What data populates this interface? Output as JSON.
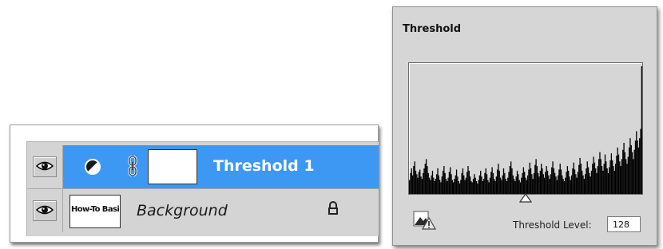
{
  "layers": {
    "items": [
      {
        "name": "Threshold 1",
        "selected": true,
        "kind": "adjustment",
        "thumbnail": "white-mask"
      },
      {
        "name": "Background",
        "selected": false,
        "kind": "pixel",
        "thumbnail_text": "How-To Basic",
        "locked": true
      }
    ],
    "selected_color": "#3d98f4",
    "icons": [
      "eye-icon",
      "adjustment-layer-icon",
      "link-chain-icon",
      "lock-icon"
    ]
  },
  "threshold_dialog": {
    "title": "Threshold",
    "level_label": "Threshold Level:",
    "level_value": "128",
    "level": 128,
    "range": [
      0,
      255
    ],
    "histogram": [
      12,
      18,
      22,
      16,
      24,
      28,
      20,
      17,
      14,
      19,
      21,
      15,
      13,
      18,
      22,
      26,
      30,
      24,
      18,
      14,
      12,
      16,
      20,
      14,
      11,
      13,
      17,
      22,
      16,
      12,
      10,
      15,
      20,
      24,
      18,
      13,
      11,
      14,
      19,
      23,
      17,
      12,
      10,
      13,
      16,
      21,
      15,
      11,
      9,
      12,
      18,
      22,
      16,
      12,
      14,
      19,
      24,
      20,
      15,
      11,
      10,
      13,
      17,
      14,
      11,
      9,
      12,
      16,
      20,
      15,
      11,
      13,
      18,
      22,
      17,
      12,
      10,
      14,
      19,
      23,
      18,
      13,
      11,
      15,
      21,
      26,
      20,
      14,
      12,
      16,
      22,
      18,
      13,
      11,
      14,
      19,
      24,
      28,
      22,
      16,
      13,
      11,
      15,
      20,
      17,
      12,
      10,
      14,
      18,
      23,
      19,
      14,
      12,
      16,
      21,
      27,
      22,
      17,
      13,
      18,
      25,
      30,
      24,
      18,
      15,
      20,
      26,
      22,
      17,
      14,
      19,
      24,
      20,
      16,
      13,
      17,
      23,
      28,
      22,
      18,
      15,
      12,
      16,
      21,
      26,
      21,
      16,
      13,
      11,
      14,
      19,
      24,
      20,
      15,
      12,
      16,
      22,
      27,
      21,
      17,
      14,
      19,
      25,
      31,
      26,
      20,
      16,
      13,
      17,
      22,
      28,
      23,
      18,
      15,
      20,
      26,
      32,
      27,
      22,
      18,
      24,
      30,
      36,
      30,
      24,
      20,
      26,
      34,
      28,
      22,
      18,
      23,
      29,
      35,
      29,
      24,
      20,
      26,
      33,
      40,
      34,
      28,
      24,
      30,
      38,
      44,
      36,
      30,
      26,
      32,
      40,
      48,
      42,
      36,
      30,
      38,
      46,
      54,
      46,
      40,
      48,
      56,
      110
    ]
  }
}
